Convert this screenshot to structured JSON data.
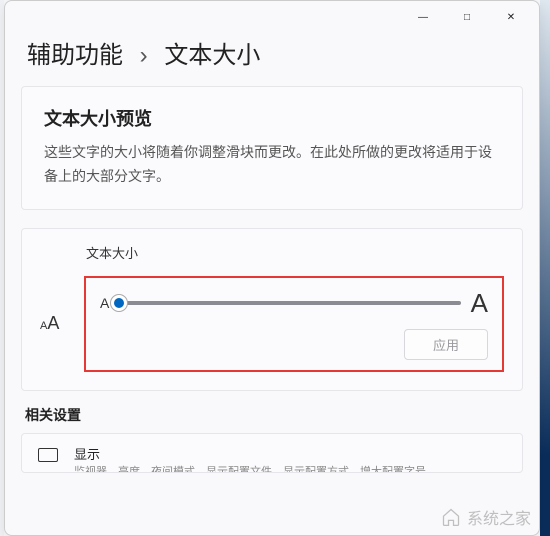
{
  "titlebar": {
    "minimize": "—",
    "maximize": "□",
    "close": "✕"
  },
  "breadcrumb": {
    "parent": "辅助功能",
    "separator": "›",
    "current": "文本大小"
  },
  "preview": {
    "title": "文本大小预览",
    "description": "这些文字的大小将随着你调整滑块而更改。在此处所做的更改将适用于设备上的大部分文字。"
  },
  "textSize": {
    "label": "文本大小",
    "iconSmallA": "A",
    "iconBigA": "A",
    "sliderMinLabel": "A",
    "sliderMaxLabel": "A",
    "applyLabel": "应用",
    "sliderValuePercent": 0
  },
  "related": {
    "heading": "相关设置",
    "display": {
      "title": "显示",
      "subtitle": "监视器、亮度、夜间模式、显示配置文件、显示配置方式、增大配置字号"
    }
  },
  "watermark": "系统之家"
}
